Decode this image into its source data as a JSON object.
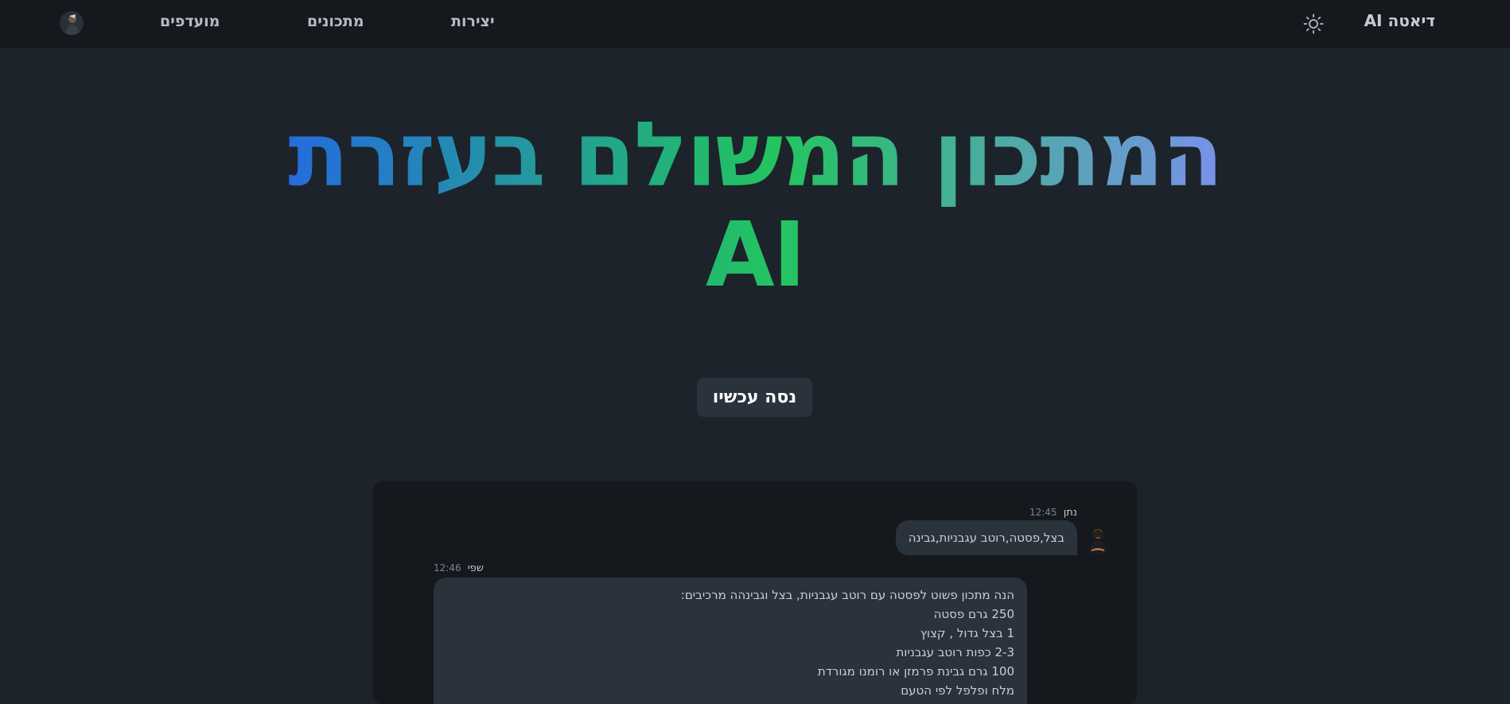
{
  "navbar": {
    "brand": "דיאטה AI",
    "theme_toggle_icon": "sun-icon",
    "links": [
      "יצירות",
      "מתכונים",
      "מועדפים"
    ],
    "avatar_icon": "user-avatar"
  },
  "hero": {
    "title_line1": "המתכון המשולם בעזרת",
    "title_line2": "AI",
    "gradient": [
      "#2563eb",
      "#22c55e",
      "#818cf8"
    ],
    "cta_label": "נסה עכשיו"
  },
  "chat": {
    "messages": [
      {
        "sender": "נתן",
        "time": "12:45",
        "text": "בצל,פסטה,רוטב עגבניות,גבינה"
      },
      {
        "sender": "שפי",
        "time": "12:46",
        "lines": [
          "הנה מתכון פשוט לפסטה עם רוטב עגבניות, בצל וגבינהה מרכיבים:",
          "250 גרם פסטה",
          "1 בצל גדול , קצוץ",
          "2-3 כפות רוטב עגבניות",
          "100 גרם גבינת פרמזן או רומנו מגורדת",
          "מלח ופלפל לפי הטעם"
        ]
      }
    ]
  },
  "colors": {
    "page_bg": "#1d232a",
    "navbar_bg": "#15191e",
    "bubble_bg": "#2a323c",
    "button_bg": "#2a323c"
  }
}
